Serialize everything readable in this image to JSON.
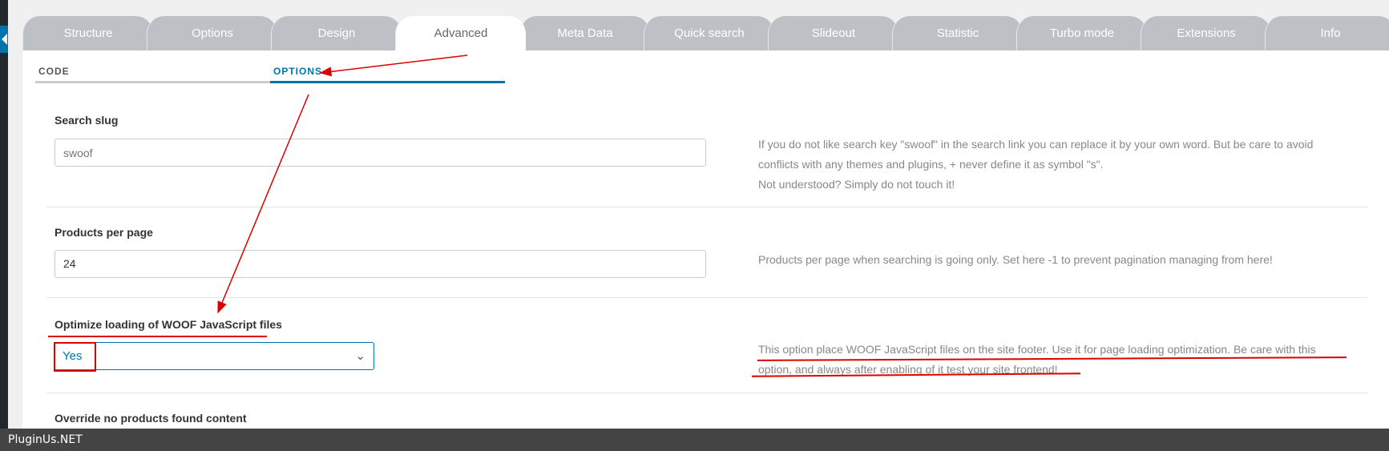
{
  "tabs": [
    "Structure",
    "Options",
    "Design",
    "Advanced",
    "Meta Data",
    "Quick search",
    "Slideout",
    "Statistic",
    "Turbo mode",
    "Extensions",
    "Info"
  ],
  "active_tab": "Advanced",
  "subtabs": {
    "code": "CODE",
    "options": "OPTIONS"
  },
  "search_slug": {
    "label": "Search slug",
    "placeholder": "swoof",
    "desc1": "If you do not like search key \"swoof\" in the search link you can replace it by your own word. But be care to avoid",
    "desc2": "conflicts with any themes and plugins, + never define it as symbol \"s\".",
    "desc3": "Not understood? Simply do not touch it!"
  },
  "products_per_page": {
    "label": "Products per page",
    "value": "24",
    "desc": "Products per page when searching is going only. Set here -1 to prevent pagination managing from here!"
  },
  "optimize_js": {
    "label": "Optimize loading of WOOF JavaScript files",
    "value": "Yes",
    "desc1": "This option place WOOF JavaScript files on the site footer. Use it for page loading optimization. Be care with this",
    "desc2": "option, and always after enabling of it test your site frontend!"
  },
  "override": {
    "label": "Override no products found content"
  },
  "footer": "PluginUs.NET",
  "colors": {
    "accent": "#0073aa",
    "annotation": "#dd0000"
  }
}
